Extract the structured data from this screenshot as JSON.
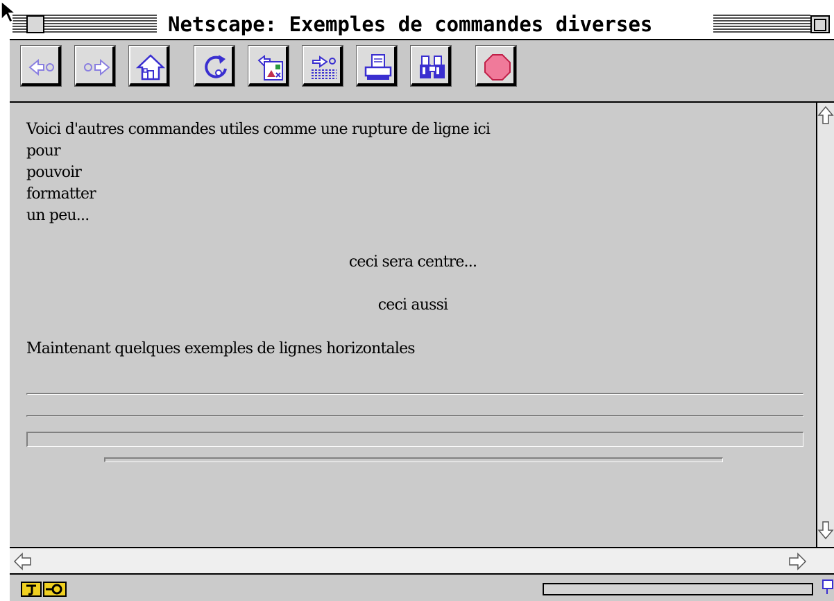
{
  "window": {
    "title": "Netscape: Exemples de commandes diverses"
  },
  "toolbar": {
    "buttons": [
      {
        "name": "back-icon"
      },
      {
        "name": "forward-icon"
      },
      {
        "name": "home-icon"
      },
      {
        "name": "reload-icon"
      },
      {
        "name": "images-icon"
      },
      {
        "name": "open-icon"
      },
      {
        "name": "print-icon"
      },
      {
        "name": "find-icon"
      },
      {
        "name": "stop-icon"
      }
    ],
    "icon_color": "#3a2fd0",
    "stop_color": "#f07a9a"
  },
  "content": {
    "lines": [
      "Voici d'autres commandes utiles comme une rupture de ligne ici",
      "pour",
      "pouvoir",
      "formatter",
      "un peu..."
    ],
    "centered": [
      "ceci sera centre...",
      "ceci aussi"
    ],
    "paragraph": "Maintenant quelques exemples de lignes horizontales"
  },
  "colors": {
    "window_background": "#cbcbcb",
    "title_background": "#ffffff"
  }
}
